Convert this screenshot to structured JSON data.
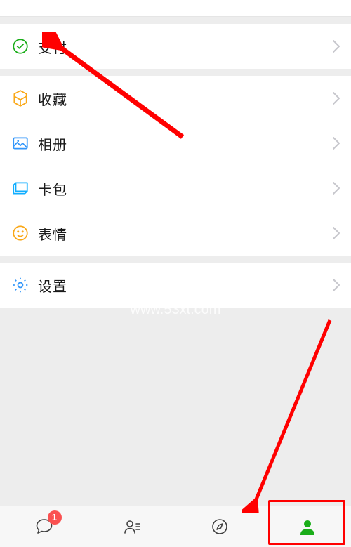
{
  "menu": {
    "group1": [
      {
        "label": "支付",
        "icon": "pay"
      }
    ],
    "group2": [
      {
        "label": "收藏",
        "icon": "favorites"
      },
      {
        "label": "相册",
        "icon": "album"
      },
      {
        "label": "卡包",
        "icon": "cards"
      },
      {
        "label": "表情",
        "icon": "sticker"
      }
    ],
    "group3": [
      {
        "label": "设置",
        "icon": "settings"
      }
    ]
  },
  "tabbar": {
    "chats_badge": "1"
  },
  "watermark": "www.53xt.com"
}
